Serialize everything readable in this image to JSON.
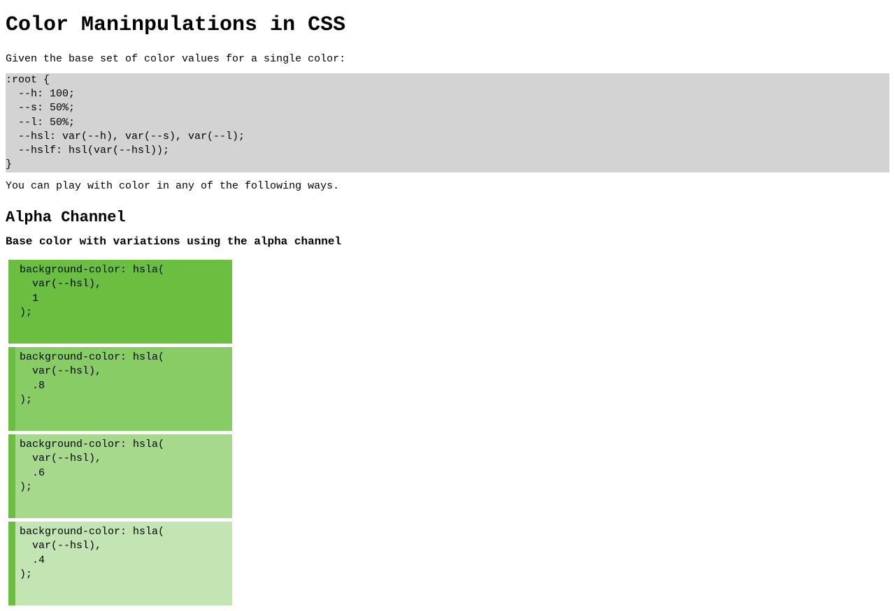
{
  "title": "Color Maninpulations in CSS",
  "intro": "Given the base set of color values for a single color:",
  "root_code": ":root {\n  --h: 100;\n  --s: 50%;\n  --l: 50%;\n  --hsl: var(--h), var(--s), var(--l);\n  --hslf: hsl(var(--hsl));\n}",
  "after_code": "You can play with color in any of the following ways.",
  "section": {
    "heading": "Alpha Channel",
    "subheading": "Base color with variations using the alpha channel"
  },
  "swatches": [
    "background-color: hsla(\n  var(--hsl),\n  1\n);",
    "background-color: hsla(\n  var(--hsl),\n  .8\n);",
    "background-color: hsla(\n  var(--hsl),\n  .6\n);",
    "background-color: hsla(\n  var(--hsl),\n  .4\n);"
  ]
}
